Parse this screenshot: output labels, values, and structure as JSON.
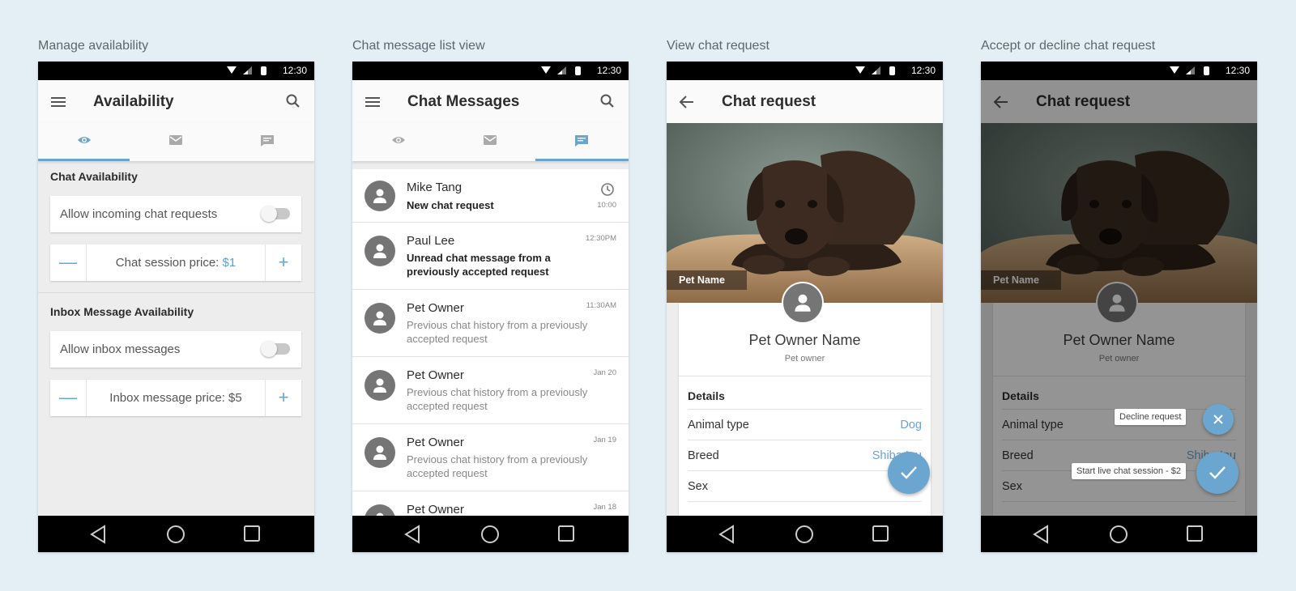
{
  "captions": [
    "Manage availability",
    "Chat message list view",
    "View chat request",
    "Accept or decline chat request"
  ],
  "status_time": "12:30",
  "availability": {
    "title": "Availability",
    "chat_section": "Chat Availability",
    "allow_chat_label": "Allow incoming chat requests",
    "chat_price_label": "Chat session price: ",
    "chat_price_value": "$1",
    "inbox_section": "Inbox Message Availability",
    "allow_inbox_label": "Allow inbox messages",
    "inbox_price_label": "Inbox message price: $5",
    "minus": "—",
    "plus": "+"
  },
  "chat_list": {
    "title": "Chat Messages",
    "items": [
      {
        "name": "Mike Tang",
        "message": "New chat request",
        "time": "10:00",
        "bold": true
      },
      {
        "name": "Paul Lee",
        "message": "Unread chat message from a previously accepted request",
        "time": "12:30PM",
        "bold": true
      },
      {
        "name": "Pet Owner",
        "message": "Previous chat history from a previously accepted request",
        "time": "11:30AM",
        "bold": false
      },
      {
        "name": "Pet Owner",
        "message": "Previous chat history from a previously accepted request",
        "time": "Jan 20",
        "bold": false
      },
      {
        "name": "Pet Owner",
        "message": "Previous chat history from a previously accepted request",
        "time": "Jan 19",
        "bold": false
      },
      {
        "name": "Pet Owner",
        "message": "",
        "time": "Jan 18",
        "bold": false
      }
    ]
  },
  "chat_request": {
    "title": "Chat request",
    "pet_name": "Pet Name",
    "owner_name": "Pet Owner Name",
    "owner_role": "Pet owner",
    "details_title": "Details",
    "details": [
      {
        "label": "Animal type",
        "value": "Dog"
      },
      {
        "label": "Breed",
        "value": "Shiba Inu"
      },
      {
        "label": "Sex",
        "value": ""
      }
    ]
  },
  "accept_decline": {
    "title": "Chat request",
    "decline_tooltip": "Decline request",
    "accept_tooltip": "Start live chat session - $2"
  },
  "colors": {
    "accent": "#6ba4cc",
    "fab": "#6aa6d0",
    "background": "#e4eef5"
  }
}
